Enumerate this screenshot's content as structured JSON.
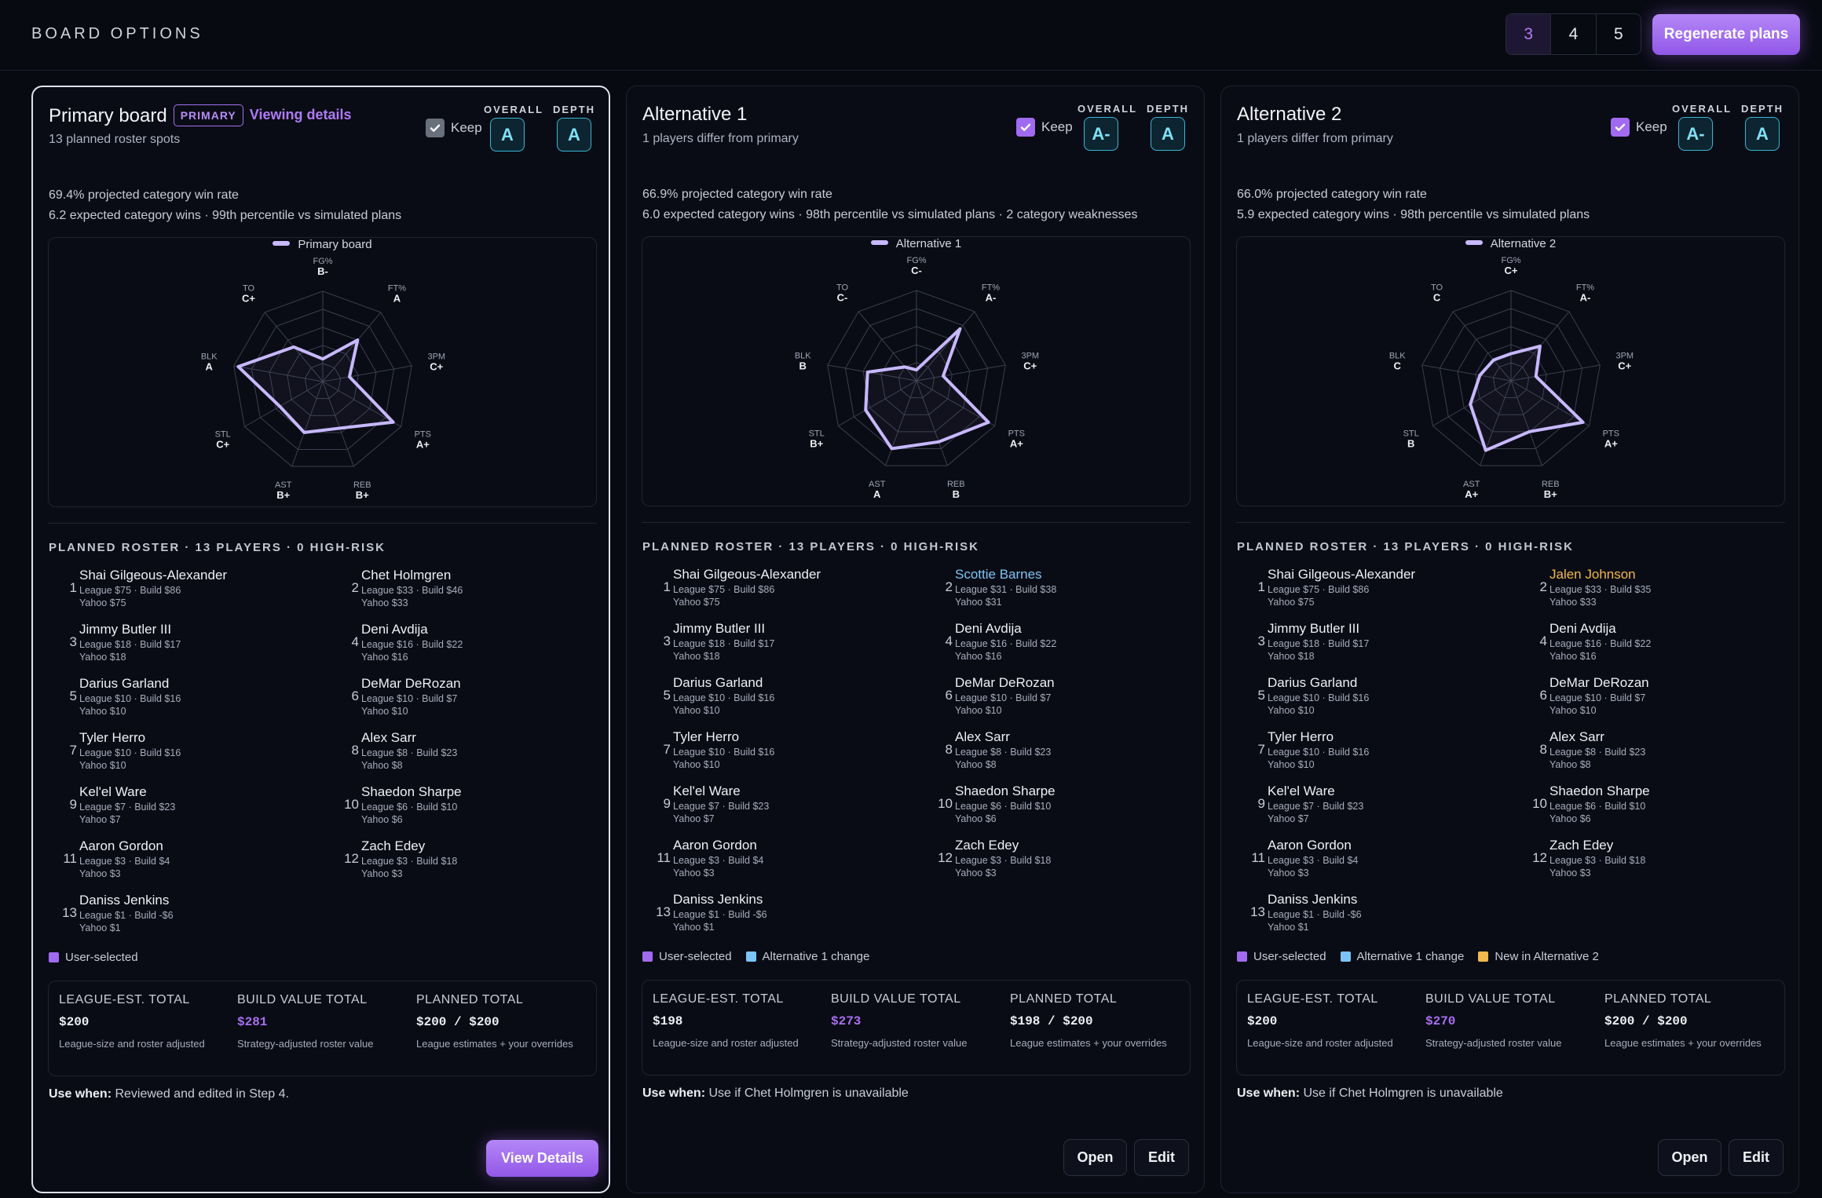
{
  "header": {
    "title": "BOARD OPTIONS",
    "plan_counts": [
      "3",
      "4",
      "5"
    ],
    "active_count": "3",
    "regen_label": "Regenerate plans"
  },
  "colors": {
    "accent": "#a06bf0",
    "grade": "#39b5d4",
    "alt1_change": "#7cc4f5",
    "new_alt2": "#f2b84b",
    "radar_line": "#c8b8ff"
  },
  "labels": {
    "keep": "Keep",
    "overall": "OVERALL",
    "depth": "DEPTH",
    "primary_badge": "PRIMARY",
    "viewing_details": "Viewing details",
    "league_total": "LEAGUE-EST. TOTAL",
    "build_total": "BUILD VALUE TOTAL",
    "planned_total": "PLANNED TOTAL",
    "league_desc": "League-size and roster adjusted",
    "build_desc": "Strategy-adjusted roster value",
    "planned_desc": "League estimates + your overrides",
    "use_when": "Use when:",
    "view_details": "View Details",
    "open": "Open",
    "edit": "Edit"
  },
  "radar_axes": [
    "FG%",
    "FT%",
    "3PM",
    "PTS",
    "REB",
    "AST",
    "STL",
    "BLK",
    "TO"
  ],
  "cards": [
    {
      "title": "Primary board",
      "subtitle": "13 planned roster spots",
      "keep_checked": true,
      "overall": "A",
      "depth": "A",
      "stat1": "69.4% projected category win rate",
      "stat2": "6.2 expected category wins · 99th percentile vs simulated plans",
      "legend": "Primary board",
      "grades": [
        "B-",
        "A",
        "C+",
        "A+",
        "B+",
        "B+",
        "C+",
        "A",
        "C+"
      ],
      "radar": [
        0.25,
        0.6,
        0.3,
        0.9,
        0.55,
        0.6,
        0.55,
        0.95,
        0.5
      ],
      "roster_header": "PLANNED ROSTER · 13 PLAYERS · 0 HIGH-RISK",
      "players": [
        {
          "num": "1",
          "name": "Shai Gilgeous-Alexander",
          "line1": "League $75 · Build $86",
          "line2": "Yahoo $75"
        },
        {
          "num": "2",
          "name": "Chet Holmgren",
          "line1": "League $33 · Build $46",
          "line2": "Yahoo $33"
        },
        {
          "num": "3",
          "name": "Jimmy Butler III",
          "line1": "League $18 · Build $17",
          "line2": "Yahoo $18"
        },
        {
          "num": "4",
          "name": "Deni Avdija",
          "line1": "League $16 · Build $22",
          "line2": "Yahoo $16"
        },
        {
          "num": "5",
          "name": "Darius Garland",
          "line1": "League $10 · Build $16",
          "line2": "Yahoo $10"
        },
        {
          "num": "6",
          "name": "DeMar DeRozan",
          "line1": "League $10 · Build $7",
          "line2": "Yahoo $10"
        },
        {
          "num": "7",
          "name": "Tyler Herro",
          "line1": "League $10 · Build $16",
          "line2": "Yahoo $10"
        },
        {
          "num": "8",
          "name": "Alex Sarr",
          "line1": "League $8 · Build $23",
          "line2": "Yahoo $8"
        },
        {
          "num": "9",
          "name": "Kel'el Ware",
          "line1": "League $7 · Build $23",
          "line2": "Yahoo $7"
        },
        {
          "num": "10",
          "name": "Shaedon Sharpe",
          "line1": "League $6 · Build $10",
          "line2": "Yahoo $6"
        },
        {
          "num": "11",
          "name": "Aaron Gordon",
          "line1": "League $3 · Build $4",
          "line2": "Yahoo $3"
        },
        {
          "num": "12",
          "name": "Zach Edey",
          "line1": "League $3 · Build $18",
          "line2": "Yahoo $3"
        },
        {
          "num": "13",
          "name": "Daniss Jenkins",
          "line1": "League $1 · Build -$6",
          "line2": "Yahoo $1"
        }
      ],
      "keys": [
        "User-selected"
      ],
      "league_total": "$200",
      "build_total": "$281",
      "planned_total": "$200 / $200",
      "use_when": "Reviewed and edited in Step 4."
    },
    {
      "title": "Alternative 1",
      "subtitle": "1 players differ from primary",
      "keep_checked": true,
      "overall": "A-",
      "depth": "A",
      "stat1": "66.9% projected category win rate",
      "stat2": "6.0 expected category wins · 98th percentile vs simulated plans · 2 category weaknesses",
      "legend": "Alternative 1",
      "grades": [
        "C-",
        "A-",
        "C+",
        "A+",
        "B",
        "A",
        "B+",
        "B",
        "C-"
      ],
      "radar": [
        0.12,
        0.75,
        0.3,
        0.92,
        0.72,
        0.8,
        0.65,
        0.55,
        0.2
      ],
      "roster_header": "PLANNED ROSTER · 13 PLAYERS · 0 HIGH-RISK",
      "players": [
        {
          "num": "1",
          "name": "Shai Gilgeous-Alexander",
          "line1": "League $75 · Build $86",
          "line2": "Yahoo $75"
        },
        {
          "num": "2",
          "name": "Scottie Barnes",
          "line1": "League $31 · Build $38",
          "line2": "Yahoo $31",
          "highlight": "alt1"
        },
        {
          "num": "3",
          "name": "Jimmy Butler III",
          "line1": "League $18 · Build $17",
          "line2": "Yahoo $18"
        },
        {
          "num": "4",
          "name": "Deni Avdija",
          "line1": "League $16 · Build $22",
          "line2": "Yahoo $16"
        },
        {
          "num": "5",
          "name": "Darius Garland",
          "line1": "League $10 · Build $16",
          "line2": "Yahoo $10"
        },
        {
          "num": "6",
          "name": "DeMar DeRozan",
          "line1": "League $10 · Build $7",
          "line2": "Yahoo $10"
        },
        {
          "num": "7",
          "name": "Tyler Herro",
          "line1": "League $10 · Build $16",
          "line2": "Yahoo $10"
        },
        {
          "num": "8",
          "name": "Alex Sarr",
          "line1": "League $8 · Build $23",
          "line2": "Yahoo $8"
        },
        {
          "num": "9",
          "name": "Kel'el Ware",
          "line1": "League $7 · Build $23",
          "line2": "Yahoo $7"
        },
        {
          "num": "10",
          "name": "Shaedon Sharpe",
          "line1": "League $6 · Build $10",
          "line2": "Yahoo $6"
        },
        {
          "num": "11",
          "name": "Aaron Gordon",
          "line1": "League $3 · Build $4",
          "line2": "Yahoo $3"
        },
        {
          "num": "12",
          "name": "Zach Edey",
          "line1": "League $3 · Build $18",
          "line2": "Yahoo $3"
        },
        {
          "num": "13",
          "name": "Daniss Jenkins",
          "line1": "League $1 · Build -$6",
          "line2": "Yahoo $1"
        }
      ],
      "keys": [
        "User-selected",
        "Alternative 1 change"
      ],
      "league_total": "$198",
      "build_total": "$273",
      "planned_total": "$198 / $200",
      "use_when": "Use if Chet Holmgren is unavailable"
    },
    {
      "title": "Alternative 2",
      "subtitle": "1 players differ from primary",
      "keep_checked": true,
      "overall": "A-",
      "depth": "A",
      "stat1": "66.0% projected category win rate",
      "stat2": "5.9 expected category wins · 98th percentile vs simulated plans",
      "legend": "Alternative 2",
      "grades": [
        "C+",
        "A-",
        "C+",
        "A+",
        "B+",
        "A+",
        "B",
        "C",
        "C"
      ],
      "radar": [
        0.3,
        0.5,
        0.28,
        0.92,
        0.6,
        0.82,
        0.52,
        0.35,
        0.3
      ],
      "roster_header": "PLANNED ROSTER · 13 PLAYERS · 0 HIGH-RISK",
      "players": [
        {
          "num": "1",
          "name": "Shai Gilgeous-Alexander",
          "line1": "League $75 · Build $86",
          "line2": "Yahoo $75"
        },
        {
          "num": "2",
          "name": "Jalen Johnson",
          "line1": "League $33 · Build $35",
          "line2": "Yahoo $33",
          "highlight": "alt2"
        },
        {
          "num": "3",
          "name": "Jimmy Butler III",
          "line1": "League $18 · Build $17",
          "line2": "Yahoo $18"
        },
        {
          "num": "4",
          "name": "Deni Avdija",
          "line1": "League $16 · Build $22",
          "line2": "Yahoo $16"
        },
        {
          "num": "5",
          "name": "Darius Garland",
          "line1": "League $10 · Build $16",
          "line2": "Yahoo $10"
        },
        {
          "num": "6",
          "name": "DeMar DeRozan",
          "line1": "League $10 · Build $7",
          "line2": "Yahoo $10"
        },
        {
          "num": "7",
          "name": "Tyler Herro",
          "line1": "League $10 · Build $16",
          "line2": "Yahoo $10"
        },
        {
          "num": "8",
          "name": "Alex Sarr",
          "line1": "League $8 · Build $23",
          "line2": "Yahoo $8"
        },
        {
          "num": "9",
          "name": "Kel'el Ware",
          "line1": "League $7 · Build $23",
          "line2": "Yahoo $7"
        },
        {
          "num": "10",
          "name": "Shaedon Sharpe",
          "line1": "League $6 · Build $10",
          "line2": "Yahoo $6"
        },
        {
          "num": "11",
          "name": "Aaron Gordon",
          "line1": "League $3 · Build $4",
          "line2": "Yahoo $3"
        },
        {
          "num": "12",
          "name": "Zach Edey",
          "line1": "League $3 · Build $18",
          "line2": "Yahoo $3"
        },
        {
          "num": "13",
          "name": "Daniss Jenkins",
          "line1": "League $1 · Build -$6",
          "line2": "Yahoo $1"
        }
      ],
      "keys": [
        "User-selected",
        "Alternative 1 change",
        "New in Alternative 2"
      ],
      "league_total": "$200",
      "build_total": "$270",
      "planned_total": "$200 / $200",
      "use_when": "Use if Chet Holmgren is unavailable"
    }
  ]
}
